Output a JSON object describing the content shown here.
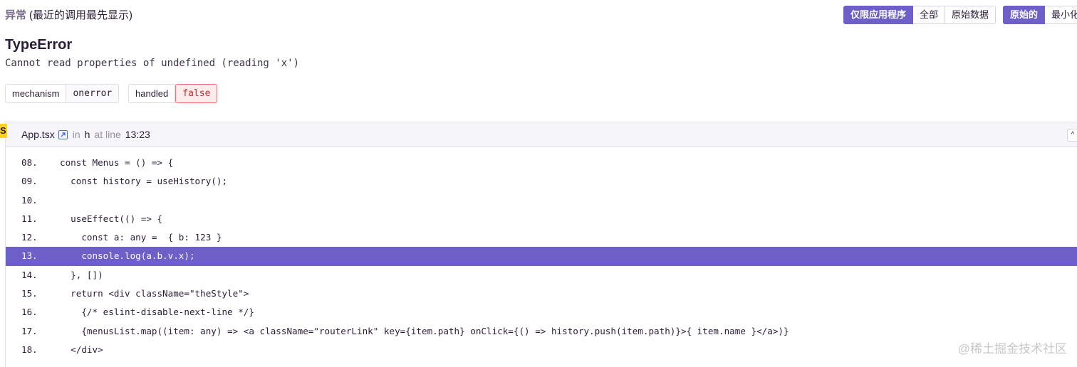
{
  "header": {
    "title": "异常",
    "subtitle": "(最近的调用最先显示)"
  },
  "toolbar": {
    "group1": [
      "仅限应用程序",
      "全部",
      "原始数据"
    ],
    "group2": [
      "原始的",
      "最小化"
    ]
  },
  "error": {
    "type": "TypeError",
    "message": "Cannot read properties of undefined (reading 'x')"
  },
  "tags": [
    {
      "key": "mechanism",
      "value": "onerror"
    },
    {
      "key": "handled",
      "value": "false"
    }
  ],
  "frame": {
    "badge": "S",
    "file": "App.tsx",
    "in_label": "in",
    "function": "h",
    "at_label": "at line",
    "position": "13:23",
    "collapse_glyph": "^"
  },
  "code_lines": [
    {
      "num": "08.",
      "src": "const Menus = () => {"
    },
    {
      "num": "09.",
      "src": "  const history = useHistory();"
    },
    {
      "num": "10.",
      "src": ""
    },
    {
      "num": "11.",
      "src": "  useEffect(() => {"
    },
    {
      "num": "12.",
      "src": "    const a: any =  { b: 123 }"
    },
    {
      "num": "13.",
      "src": "    console.log(a.b.v.x);"
    },
    {
      "num": "14.",
      "src": "  }, [])"
    },
    {
      "num": "15.",
      "src": "  return <div className=\"theStyle\">"
    },
    {
      "num": "16.",
      "src": "    {/* eslint-disable-next-line */}"
    },
    {
      "num": "17.",
      "src": "    {menusList.map((item: any) => <a className=\"routerLink\" key={item.path} onClick={() => history.push(item.path)}>{ item.name }</a>)}"
    },
    {
      "num": "18.",
      "src": "  </div>"
    }
  ],
  "highlighted_line": "13.",
  "watermark": "@稀土掘金技术社区",
  "colors": {
    "accent": "#6c5fc7",
    "badge_yellow": "#ffd320",
    "false_red": "#f36e6e"
  }
}
